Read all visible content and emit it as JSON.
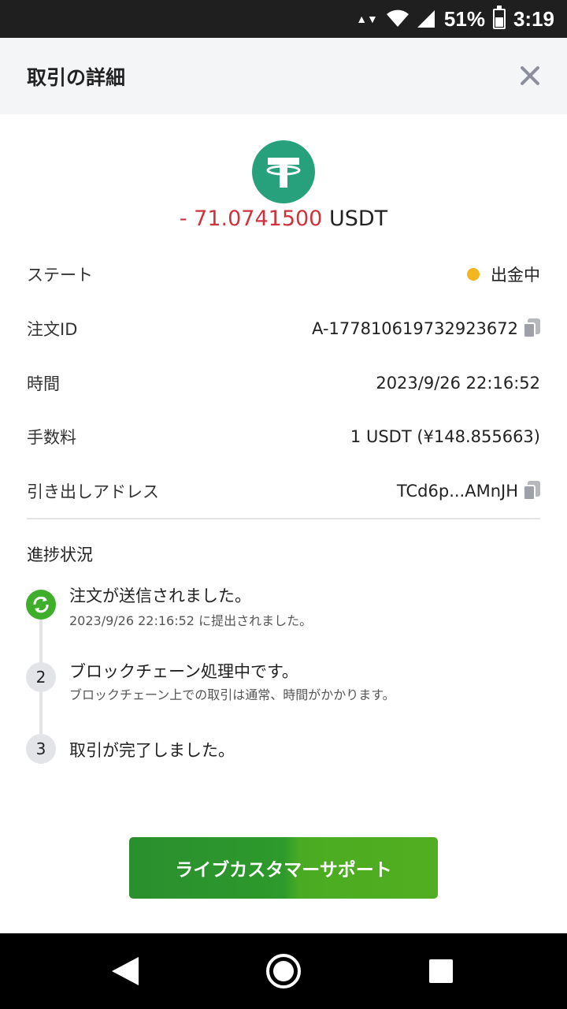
{
  "status_bar": {
    "battery": "51%",
    "time": "3:19"
  },
  "header": {
    "title": "取引の詳細"
  },
  "coin": {
    "icon": "tether-icon",
    "color": "#26a17b"
  },
  "amount": {
    "value": "- 71.0741500",
    "unit": "USDT",
    "value_color": "#d0323b"
  },
  "details": {
    "state": {
      "label": "ステート",
      "value": "出金中",
      "dot_color": "#f3b61f"
    },
    "order_id": {
      "label": "注文ID",
      "value": "A-177810619732923672"
    },
    "time": {
      "label": "時間",
      "value": "2023/9/26 22:16:52"
    },
    "fee": {
      "label": "手数料",
      "value": "1 USDT (¥148.855663)"
    },
    "address": {
      "label": "引き出しアドレス",
      "value": "TCd6p...AMnJH"
    }
  },
  "progress": {
    "title": "進捗状況",
    "steps": [
      {
        "title": "注文が送信されました。",
        "sub": "2023/9/26 22:16:52 に提出されました。"
      },
      {
        "number": "2",
        "title": "ブロックチェーン処理中です。",
        "sub": "ブロックチェーン上での取引は通常、時間がかかります。"
      },
      {
        "number": "3",
        "title": "取引が完了しました。"
      }
    ]
  },
  "support_button": {
    "label": "ライブカスタマーサポート"
  }
}
